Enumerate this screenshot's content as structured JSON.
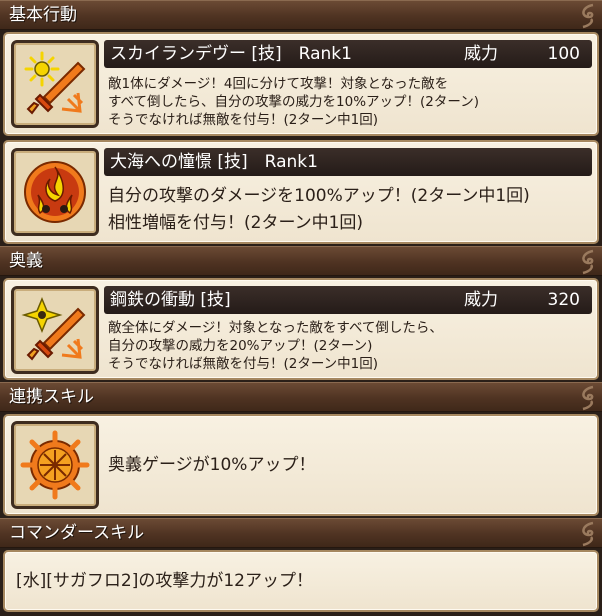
{
  "sections": {
    "basic": "基本行動",
    "ougi": "奥義",
    "renkei": "連携スキル",
    "commander": "コマンダースキル"
  },
  "skills": [
    {
      "name": "スカイランデヴー [技]　Rank1",
      "power_label": "威力",
      "power_value": "100",
      "icon": "sword-star-icon",
      "lines": [
        "敵1体にダメージ！4回に分けて攻撃！対象となった敵を",
        "すべて倒したら、自分の攻撃の威力を10%アップ！(2ターン)",
        "そうでなければ無敵を付与！(2ターン中1回)"
      ]
    },
    {
      "name": "大海への憧憬 [技]　Rank1",
      "icon": "flame-drops-icon",
      "lines": [
        "自分の攻撃のダメージを100%アップ！(2ターン中1回)",
        "相性増幅を付与！(2ターン中1回)"
      ]
    },
    {
      "name": "鋼鉄の衝動 [技]",
      "power_label": "威力",
      "power_value": "320",
      "icon": "sword-shuriken-icon",
      "lines": [
        "敵全体にダメージ！対象となった敵をすべて倒したら、",
        "自分の攻撃の威力を20%アップ！(2ターン)",
        "そうでなければ無敵を付与！(2ターン中1回)"
      ]
    }
  ],
  "link_skill": {
    "icon": "compass-burst-icon",
    "text": "奥義ゲージが10%アップ！"
  },
  "commander_skill": {
    "text": "[水][サガフロ2]の攻撃力が12アップ！"
  },
  "colors": {
    "header_bg": "#4f3322",
    "card_bg": "#f3e9d6",
    "card_border": "#a68860",
    "titlebar_bg": "#2b211d",
    "icon_orange": "#f07a1c",
    "icon_yellow": "#f5d400"
  }
}
